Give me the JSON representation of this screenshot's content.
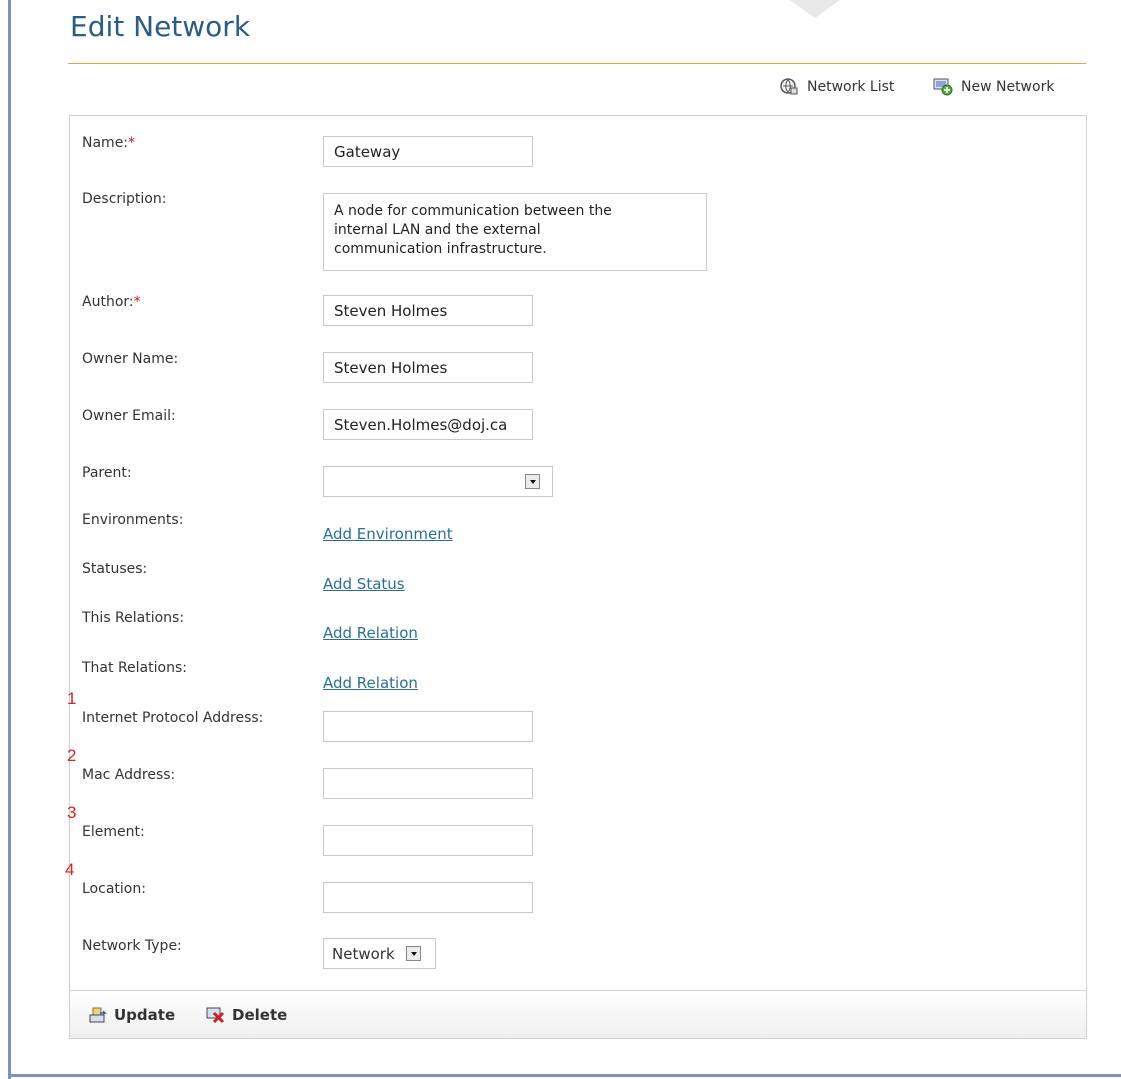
{
  "page": {
    "title": "Edit Network"
  },
  "toolbar": {
    "network_list_label": "Network List",
    "new_network_label": "New Network"
  },
  "form": {
    "name": {
      "label": "Name:",
      "required_mark": "*",
      "value": "Gateway"
    },
    "description": {
      "label": "Description:",
      "value": "A node for communication between the\ninternal LAN and the external\ncommunication infrastructure."
    },
    "author": {
      "label": "Author:",
      "required_mark": "*",
      "value": "Steven Holmes"
    },
    "owner_name": {
      "label": "Owner Name:",
      "value": "Steven Holmes"
    },
    "owner_email": {
      "label": "Owner Email:",
      "value": "Steven.Holmes@doj.ca"
    },
    "parent": {
      "label": "Parent:",
      "value": ""
    },
    "environments": {
      "label": "Environments:",
      "link": "Add Environment"
    },
    "statuses": {
      "label": "Statuses:",
      "link": "Add Status"
    },
    "this_relations": {
      "label": "This Relations:",
      "link": "Add Relation"
    },
    "that_relations": {
      "label": "That Relations:",
      "link": "Add Relation"
    },
    "ip_address": {
      "label": "Internet Protocol Address:",
      "value": ""
    },
    "mac_address": {
      "label": "Mac Address:",
      "value": ""
    },
    "element": {
      "label": "Element:",
      "value": ""
    },
    "location": {
      "label": "Location:",
      "value": ""
    },
    "network_type": {
      "label": "Network Type:",
      "value": "Network"
    }
  },
  "annotations": [
    "1",
    "2",
    "3",
    "4"
  ],
  "footer": {
    "update_label": "Update",
    "delete_label": "Delete"
  },
  "colors": {
    "title": "#2a5c85",
    "accent_rule": "#e4a246",
    "link": "#2a6f97",
    "required": "#c41a1a",
    "annotation": "#dd2222"
  },
  "icons": [
    "network-list-icon",
    "new-network-icon",
    "update-icon",
    "delete-icon",
    "dropdown-arrow-icon"
  ]
}
